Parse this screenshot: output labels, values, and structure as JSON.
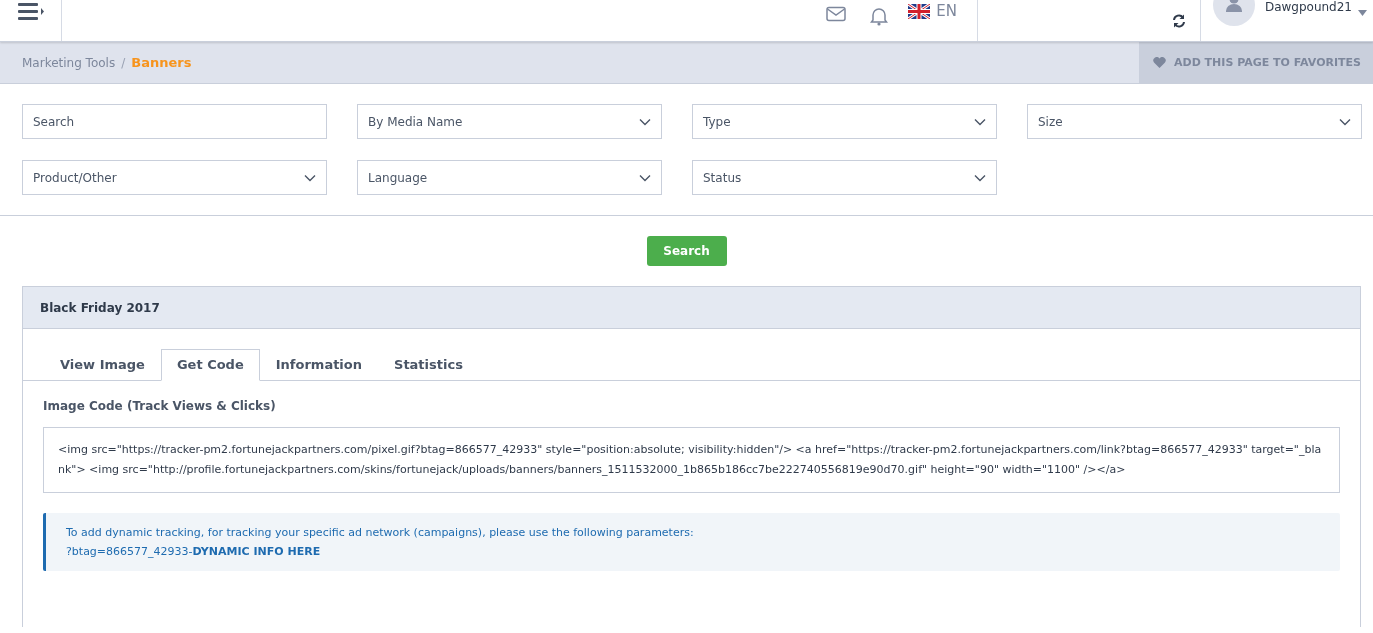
{
  "header": {
    "language": "EN",
    "username": "Dawgpound21"
  },
  "breadcrumb": {
    "items": [
      {
        "label": "Marketing Tools",
        "selected": false
      },
      {
        "label": "Banners",
        "selected": true
      }
    ],
    "separator": "/"
  },
  "favorites_button": "ADD THIS PAGE TO FAVORITES",
  "filters": [
    {
      "kind": "text",
      "placeholder": "Search"
    },
    {
      "kind": "select",
      "label": "By Media Name"
    },
    {
      "kind": "select",
      "label": "Type"
    },
    {
      "kind": "select",
      "label": "Size"
    },
    {
      "kind": "select",
      "label": "Product/Other"
    },
    {
      "kind": "select",
      "label": "Language"
    },
    {
      "kind": "select",
      "label": "Status"
    }
  ],
  "search_button": "Search",
  "panel": {
    "title": "Black Friday 2017",
    "tabs": [
      {
        "label": "View Image",
        "selected": false
      },
      {
        "label": "Get Code",
        "selected": true
      },
      {
        "label": "Information",
        "selected": false
      },
      {
        "label": "Statistics",
        "selected": false
      }
    ],
    "code_label": "Image Code (Track Views & Clicks)",
    "code": "<img src=\"https://tracker-pm2.fortunejackpartners.com/pixel.gif?btag=866577_42933\" style=\"position:absolute; visibility:hidden\"/> <a href=\"https://tracker-pm2.fortunejackpartners.com/link?btag=866577_42933\" target=\"_blank\"> <img src=\"http://profile.fortunejackpartners.com/skins/fortunejack/uploads/banners/banners_1511532000_1b865b186cc7be222740556819e90d70.gif\" height=\"90\" width=\"1100\" /></a>",
    "note": {
      "text": "To add dynamic tracking, for tracking your specific ad network (campaigns), please use the following parameters:",
      "param": "?btag=866577_42933-**DYNAMIC INFO HERE**"
    }
  }
}
